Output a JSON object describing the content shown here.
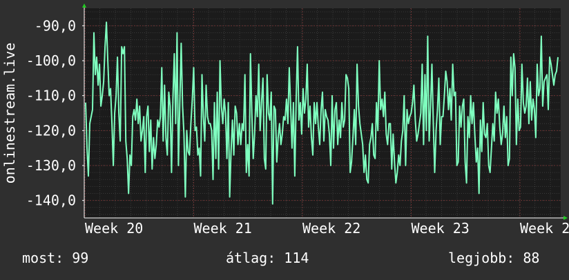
{
  "chart_data": {
    "type": "line",
    "ylabel": "onlinestream.live",
    "y_ticks": [
      -90,
      -100,
      -110,
      -120,
      -130,
      -140
    ],
    "y_tick_labels": [
      "-90,0",
      "-100,0",
      "-110,0",
      "-120,0",
      "-130,0",
      "-140,0"
    ],
    "ylim": [
      -145,
      -85
    ],
    "x_tick_labels": [
      "Week 20",
      "Week 21",
      "Week 22",
      "Week 23",
      "Week 2"
    ],
    "grid": true,
    "series": [
      {
        "color": "#7fffbf",
        "values": [
          -112,
          -125,
          -133,
          -118,
          -116,
          -114,
          -92,
          -104,
          -99,
          -107,
          -101,
          -113,
          -110,
          -106,
          -96,
          -89,
          -100,
          -110,
          -108,
          -118,
          -130,
          -115,
          -110,
          -99,
          -115,
          -123,
          -96,
          -98,
          -96,
          -123,
          -128,
          -138,
          -127,
          -130,
          -116,
          -114,
          -117,
          -111,
          -118,
          -113,
          -123,
          -120,
          -116,
          -132,
          -116,
          -113,
          -126,
          -117,
          -131,
          -122,
          -128,
          -124,
          -117,
          -119,
          -116,
          -102,
          -123,
          -107,
          -122,
          -127,
          -109,
          -113,
          -132,
          -111,
          -98,
          -118,
          -92,
          -130,
          -112,
          -95,
          -113,
          -121,
          -139,
          -120,
          -126,
          -127,
          -118,
          -111,
          -102,
          -120,
          -119,
          -127,
          -125,
          -133,
          -104,
          -116,
          -123,
          -107,
          -116,
          -118,
          -118,
          -120,
          -134,
          -112,
          -128,
          -109,
          -131,
          -100,
          -113,
          -118,
          -111,
          -115,
          -128,
          -112,
          -139,
          -126,
          -117,
          -127,
          -113,
          -115,
          -124,
          -118,
          -124,
          -118,
          -120,
          -104,
          -132,
          -124,
          -133,
          -98,
          -115,
          -128,
          -121,
          -110,
          -116,
          -101,
          -120,
          -112,
          -105,
          -128,
          -131,
          -104,
          -115,
          -117,
          -109,
          -141,
          -113,
          -114,
          -129,
          -122,
          -118,
          -124,
          -121,
          -116,
          -117,
          -111,
          -118,
          -102,
          -113,
          -125,
          -112,
          -133,
          -111,
          -96,
          -117,
          -112,
          -121,
          -108,
          -115,
          -111,
          -101,
          -119,
          -113,
          -122,
          -127,
          -112,
          -118,
          -112,
          -119,
          -124,
          -114,
          -109,
          -123,
          -114,
          -116,
          -117,
          -121,
          -130,
          -110,
          -125,
          -114,
          -112,
          -124,
          -117,
          -122,
          -112,
          -119,
          -117,
          -104,
          -105,
          -108,
          -132,
          -129,
          -122,
          -114,
          -124,
          -101,
          -113,
          -118,
          -121,
          -124,
          -132,
          -127,
          -134,
          -135,
          -124,
          -122,
          -118,
          -127,
          -128,
          -112,
          -120,
          -100,
          -114,
          -111,
          -116,
          -109,
          -121,
          -124,
          -118,
          -118,
          -131,
          -121,
          -129,
          -135,
          -132,
          -127,
          -130,
          -123,
          -120,
          -110,
          -130,
          -114,
          -118,
          -116,
          -115,
          -112,
          -107,
          -117,
          -123,
          -121,
          -118,
          -115,
          -101,
          -124,
          -104,
          -120,
          -93,
          -123,
          -113,
          -101,
          -118,
          -132,
          -120,
          -114,
          -105,
          -124,
          -116,
          -116,
          -110,
          -103,
          -106,
          -114,
          -108,
          -117,
          -101,
          -110,
          -109,
          -130,
          -129,
          -113,
          -119,
          -113,
          -111,
          -129,
          -135,
          -116,
          -122,
          -110,
          -118,
          -112,
          -121,
          -129,
          -125,
          -138,
          -117,
          -126,
          -112,
          -121,
          -122,
          -118,
          -130,
          -132,
          -125,
          -118,
          -123,
          -109,
          -115,
          -111,
          -119,
          -124,
          -121,
          -113,
          -122,
          -116,
          -130,
          -128,
          -99,
          -110,
          -98,
          -102,
          -124,
          -111,
          -120,
          -119,
          -101,
          -112,
          -115,
          -113,
          -105,
          -118,
          -106,
          -117,
          -111,
          -114,
          -122,
          -101,
          -110,
          -108,
          -93,
          -113,
          -106,
          -105,
          -104,
          -114,
          -99,
          -101,
          -104,
          -107,
          -104,
          -103,
          -99
        ]
      }
    ],
    "stats": {
      "current_label": "most:",
      "current_value": "99",
      "average_label": "átlag:",
      "average_value": "114",
      "best_label": "legjobb:",
      "best_value": "88"
    }
  }
}
